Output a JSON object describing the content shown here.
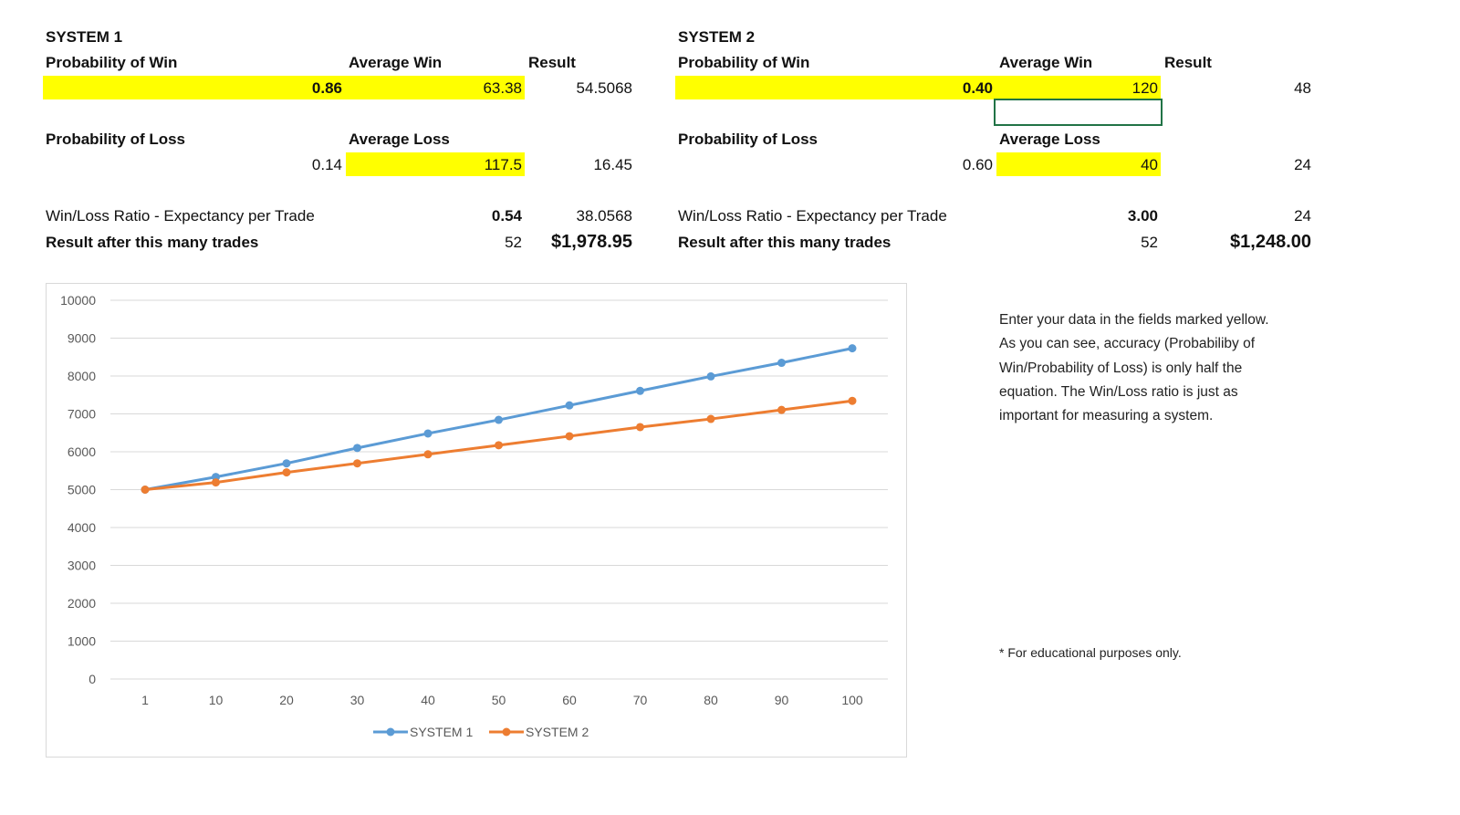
{
  "system1": {
    "title": "SYSTEM 1",
    "prob_win_label": "Probability of Win",
    "avg_win_label": "Average Win",
    "result_label": "Result",
    "prob_win": "0.86",
    "avg_win": "63.38",
    "win_result": "54.5068",
    "prob_loss_label": "Probability of Loss",
    "avg_loss_label": "Average Loss",
    "prob_loss": "0.14",
    "avg_loss": "117.5",
    "loss_result": "16.45",
    "ratio_label": "Win/Loss Ratio - Expectancy per Trade",
    "ratio": "0.54",
    "expectancy": "38.0568",
    "trades_label": "Result after this many trades",
    "trades": "52",
    "total": "$1,978.95"
  },
  "system2": {
    "title": "SYSTEM 2",
    "prob_win_label": "Probability of Win",
    "avg_win_label": "Average Win",
    "result_label": "Result",
    "prob_win": "0.40",
    "avg_win": "120",
    "win_result": "48",
    "prob_loss_label": "Probability of Loss",
    "avg_loss_label": "Average Loss",
    "prob_loss": "0.60",
    "avg_loss": "40",
    "loss_result": "24",
    "ratio_label": "Win/Loss Ratio - Expectancy per Trade",
    "ratio": "3.00",
    "expectancy": "24",
    "trades_label": "Result after this many trades",
    "trades": "52",
    "total": "$1,248.00"
  },
  "notes": {
    "lines": [
      "Enter your data in the fields marked yellow.",
      "As you can see, accuracy (Probabiliby of",
      "Win/Probability of Loss) is only half the",
      "equation. The Win/Loss ratio is just as",
      "important for measuring a system."
    ],
    "disclaimer": "* For educational purposes only."
  },
  "chart_data": {
    "type": "line",
    "categories": [
      "1",
      "10",
      "20",
      "30",
      "40",
      "50",
      "60",
      "70",
      "80",
      "90",
      "100"
    ],
    "ylim": [
      0,
      10000
    ],
    "yticks": [
      "0",
      "1000",
      "2000",
      "3000",
      "4000",
      "5000",
      "6000",
      "7000",
      "8000",
      "9000",
      "10000"
    ],
    "grid": true,
    "legend": "bottom",
    "series": [
      {
        "name": "SYSTEM 1",
        "color": "#5b9bd5",
        "values": [
          5000,
          5335,
          5694,
          6100,
          6483,
          6842,
          7225,
          7608,
          7990,
          8349,
          8732
        ]
      },
      {
        "name": "SYSTEM 2",
        "color": "#ed7d31",
        "values": [
          5000,
          5191,
          5455,
          5694,
          5933,
          6172,
          6411,
          6651,
          6866,
          7105,
          7344
        ]
      }
    ]
  }
}
